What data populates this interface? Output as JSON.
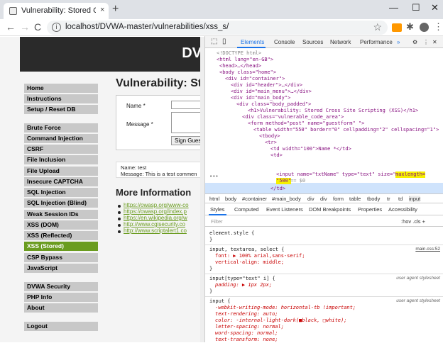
{
  "browser": {
    "tab_title": "Vulnerability: Stored Cross Site S",
    "tab_close": "×",
    "new_tab": "+",
    "url": "localhost/DVWA-master/vulnerabilities/xss_s/",
    "window_controls": {
      "minimize": "—",
      "maximize": "☐",
      "close": "✕"
    },
    "nav": {
      "back": "←",
      "forward": "→",
      "reload": "C"
    }
  },
  "site": {
    "logo": "DV",
    "menu": [
      "Home",
      "Instructions",
      "Setup / Reset DB",
      "Brute Force",
      "Command Injection",
      "CSRF",
      "File Inclusion",
      "File Upload",
      "Insecure CAPTCHA",
      "SQL Injection",
      "SQL Injection (Blind)",
      "Weak Session IDs",
      "XSS (DOM)",
      "XSS (Reflected)",
      "XSS (Stored)",
      "CSP Bypass",
      "JavaScript",
      "DVWA Security",
      "PHP Info",
      "About",
      "Logout"
    ],
    "selected_menu": "XSS (Stored)",
    "heading": "Vulnerability: St",
    "form": {
      "name_label": "Name *",
      "message_label": "Message *",
      "sign_button": "Sign Gues"
    },
    "entry": {
      "name": "Name: test",
      "message": "Message: This is a test commen"
    },
    "more_info": "More Information",
    "links": [
      "https://owasp.org/www-co",
      "https://owasp.org/index.p",
      "https://en.wikipedia.org/w",
      "http://www.cgisecurity.co",
      "http://www.scriptalert1.co"
    ]
  },
  "devtools": {
    "tabs": [
      "Elements",
      "Console",
      "Sources",
      "Network",
      "Performance"
    ],
    "more": "»",
    "breadcrumbs": [
      "html",
      "body",
      "#container",
      "#main_body",
      "div",
      "div",
      "form",
      "table",
      "tbody",
      "tr",
      "td",
      "input"
    ],
    "style_tabs": [
      "Styles",
      "Computed",
      "Event Listeners",
      "DOM Breakpoints",
      "Properties",
      "Accessibility"
    ],
    "filter_placeholder": "Filter",
    "filter_tools": ":hov  .cls  +",
    "tree": [
      "<!DOCTYPE html>",
      "<html lang=\"en-GB\">",
      "<head>…</head>",
      "<body class=\"home\">",
      "<div id=\"container\">",
      "<div id=\"header\">…</div>",
      "<div id=\"main_menu\">…</div>",
      "<div id=\"main_body\">",
      "<div class=\"body_padded\">",
      "<h1>Vulnerability: Stored Cross Site Scripting (XSS)</h1>",
      "<div class=\"vulnerable_code_area\">",
      "<form method=\"post\" name=\"guestform\" \">",
      "<table width=\"550\" border=\"0\" cellpadding=\"2\" cellspacing=\"1\">",
      "<tbody>",
      "<tr>",
      "<td width=\"100\">Name *</td>",
      "<td>",
      "<input name=\"txtName\" type=\"text\" size=\"30\"",
      "maxlength=",
      "\"500\"",
      "== $0",
      "</td>"
    ],
    "styles": {
      "element_style": "element.style {",
      "close": "}",
      "rule1_sel": "input, textarea, select {",
      "rule1_src": "main.css:52",
      "rule1_p1": "font: ▶ 100% arial,sans-serif;",
      "rule1_p2": "vertical-align: middle;",
      "rule2_sel": "input[type=\"text\" i] {",
      "rule2_src": "user agent stylesheet",
      "rule2_p1": "padding: ▶ 1px 2px;",
      "rule3_sel": "input {",
      "rule3_src": "user agent stylesheet",
      "rule3_props": [
        "-webkit-writing-mode: horizontal-tb !important;",
        "text-rendering: auto;",
        "color: -internal-light-dark(■black, □white);",
        "letter-spacing: normal;",
        "word-spacing: normal;",
        "text-transform: none;"
      ]
    }
  }
}
